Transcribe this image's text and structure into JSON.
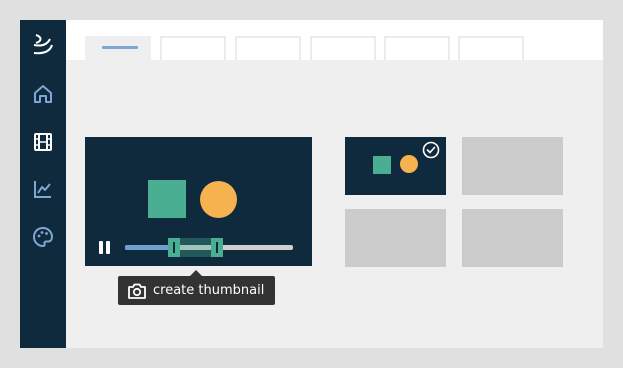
{
  "window": {
    "tabs_count_note": "",
    "colors": {
      "sidebar": "#0f2a3d",
      "accent_green": "#4aae92",
      "accent_orange": "#f5b24e",
      "progress_blue": "#6e9fd3",
      "tab_indicator": "#7fa6d4",
      "tooltip_bg": "#333333"
    }
  },
  "sidebar": {
    "items": [
      {
        "icon": "logo-icon"
      },
      {
        "icon": "home-icon"
      },
      {
        "icon": "film-icon",
        "active": true
      },
      {
        "icon": "chart-icon"
      },
      {
        "icon": "palette-icon"
      }
    ]
  },
  "tabs": [
    {
      "active": true
    },
    {
      "active": false
    },
    {
      "active": false
    },
    {
      "active": false
    },
    {
      "active": false
    },
    {
      "active": false
    }
  ],
  "player": {
    "state": "playing",
    "progress": 0.3,
    "selection_start": 0.3,
    "selection_end": 0.6
  },
  "tooltip": {
    "icon": "camera-icon",
    "label": "create thumbnail"
  },
  "thumbnails": [
    {
      "selected": true
    },
    {
      "selected": false
    },
    {
      "selected": false
    },
    {
      "selected": false
    }
  ]
}
